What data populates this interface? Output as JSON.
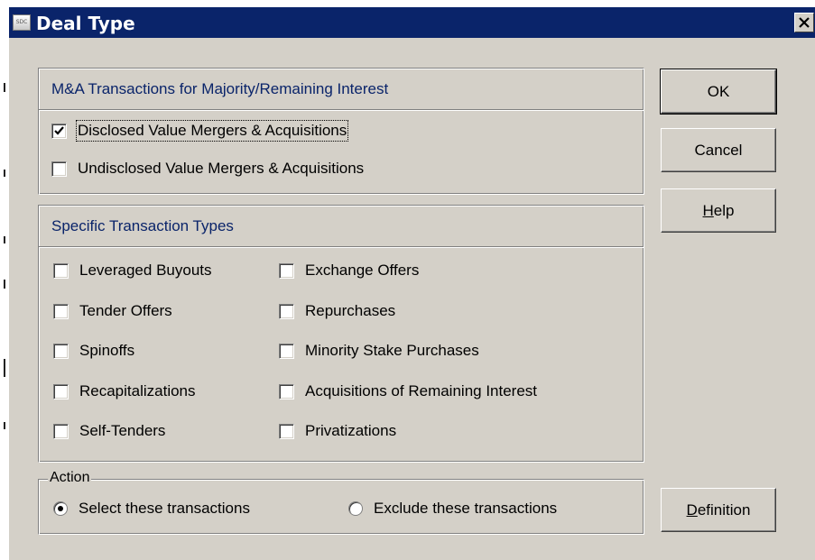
{
  "window": {
    "title": "Deal Type",
    "icon_text": "SDC",
    "close_glyph": "✕"
  },
  "ma_group": {
    "header": "M&A Transactions for Majority/Remaining Interest",
    "items": [
      {
        "label": "Disclosed Value Mergers & Acquisitions",
        "checked": true
      },
      {
        "label": "Undisclosed Value Mergers & Acquisitions",
        "checked": false
      }
    ]
  },
  "specific_group": {
    "header": "Specific Transaction Types",
    "left_items": [
      {
        "label": "Leveraged Buyouts",
        "checked": false
      },
      {
        "label": "Tender Offers",
        "checked": false
      },
      {
        "label": "Spinoffs",
        "checked": false
      },
      {
        "label": "Recapitalizations",
        "checked": false
      },
      {
        "label": "Self-Tenders",
        "checked": false
      }
    ],
    "right_items": [
      {
        "label": "Exchange Offers",
        "checked": false
      },
      {
        "label": "Repurchases",
        "checked": false
      },
      {
        "label": "Minority Stake Purchases",
        "checked": false
      },
      {
        "label": "Acquisitions of Remaining Interest",
        "checked": false
      },
      {
        "label": "Privatizations",
        "checked": false
      }
    ]
  },
  "action_group": {
    "legend": "Action",
    "options": [
      {
        "label": "Select these transactions",
        "selected": true
      },
      {
        "label": "Exclude these transactions",
        "selected": false
      }
    ]
  },
  "buttons": {
    "ok": "OK",
    "cancel": "Cancel",
    "help_mnemonic": "H",
    "help_rest": "elp",
    "definition_mnemonic": "D",
    "definition_rest": "efinition"
  },
  "colors": {
    "titlebar": "#0a246a",
    "dialog_bg": "#d4d0c8",
    "group_header_text": "#0a246a"
  }
}
